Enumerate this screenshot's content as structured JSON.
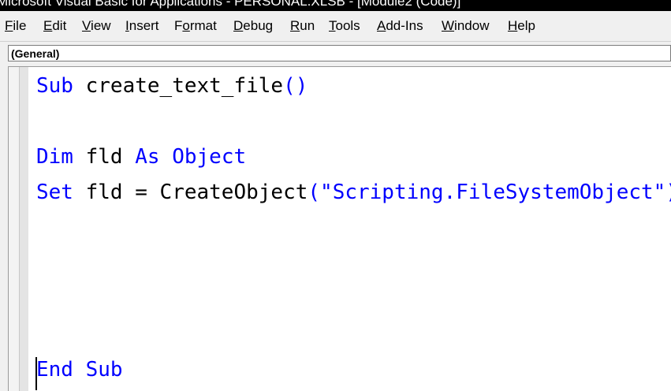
{
  "window": {
    "title": "Microsoft Visual Basic for Applications - PERSONAL.XLSB - [Module2 (Code)]"
  },
  "menu": {
    "items": [
      {
        "pre": "",
        "u": "F",
        "post": "ile"
      },
      {
        "pre": "",
        "u": "E",
        "post": "dit"
      },
      {
        "pre": "",
        "u": "V",
        "post": "iew"
      },
      {
        "pre": "",
        "u": "I",
        "post": "nsert"
      },
      {
        "pre": "F",
        "u": "o",
        "post": "rmat"
      },
      {
        "pre": "",
        "u": "D",
        "post": "ebug"
      },
      {
        "pre": "",
        "u": "R",
        "post": "un"
      },
      {
        "pre": "",
        "u": "T",
        "post": "ools"
      },
      {
        "pre": "",
        "u": "A",
        "post": "dd-Ins"
      },
      {
        "pre": "",
        "u": "W",
        "post": "indow"
      },
      {
        "pre": "",
        "u": "H",
        "post": "elp"
      }
    ]
  },
  "object_combo": {
    "value": "(General)"
  },
  "code": {
    "line1": {
      "kw1": "Sub",
      "rest": " create_text_file",
      "paren": "()"
    },
    "line2": {
      "kw1": "Dim",
      "mid": " fld ",
      "kw2": "As",
      "sp": " ",
      "kw3": "Object"
    },
    "line3": {
      "kw1": "Set",
      "mid": " fld = CreateObject",
      "str": "(\"Scripting.FileSystemObject\")"
    },
    "line4": {
      "kw1": "End",
      "sp": " ",
      "kw2": "Sub"
    }
  },
  "colors": {
    "keyword": "#0000ff",
    "text": "#000000",
    "menubar": "#f0f0f0"
  }
}
